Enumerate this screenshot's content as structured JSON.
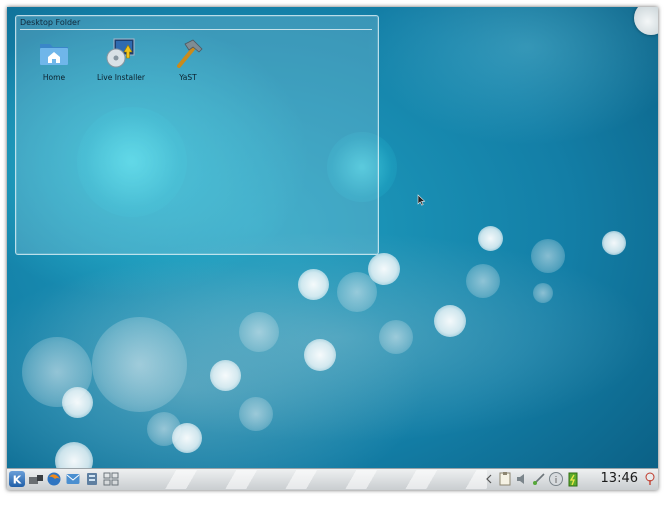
{
  "desktop": {
    "folder_view": {
      "title": "Desktop Folder",
      "icons": [
        {
          "label": "Home",
          "icon": "home-folder-icon"
        },
        {
          "label": "Live Installer",
          "icon": "live-installer-icon"
        },
        {
          "label": "YaST",
          "icon": "yast-hammer-icon"
        }
      ]
    }
  },
  "taskbar": {
    "launcher_icon": "kde-kickoff-icon",
    "quick_launch": [
      "dolphin-icon",
      "firefox-icon",
      "mail-icon",
      "network-icon",
      "pager-icon"
    ],
    "tray_icons": [
      "clipboard-icon",
      "volume-icon",
      "network-tray-icon",
      "info-icon",
      "battery-icon"
    ],
    "clock": "13:46"
  },
  "colors": {
    "desktop_blue": "#137ea6",
    "taskbar_bg": "#dfe2e4"
  }
}
